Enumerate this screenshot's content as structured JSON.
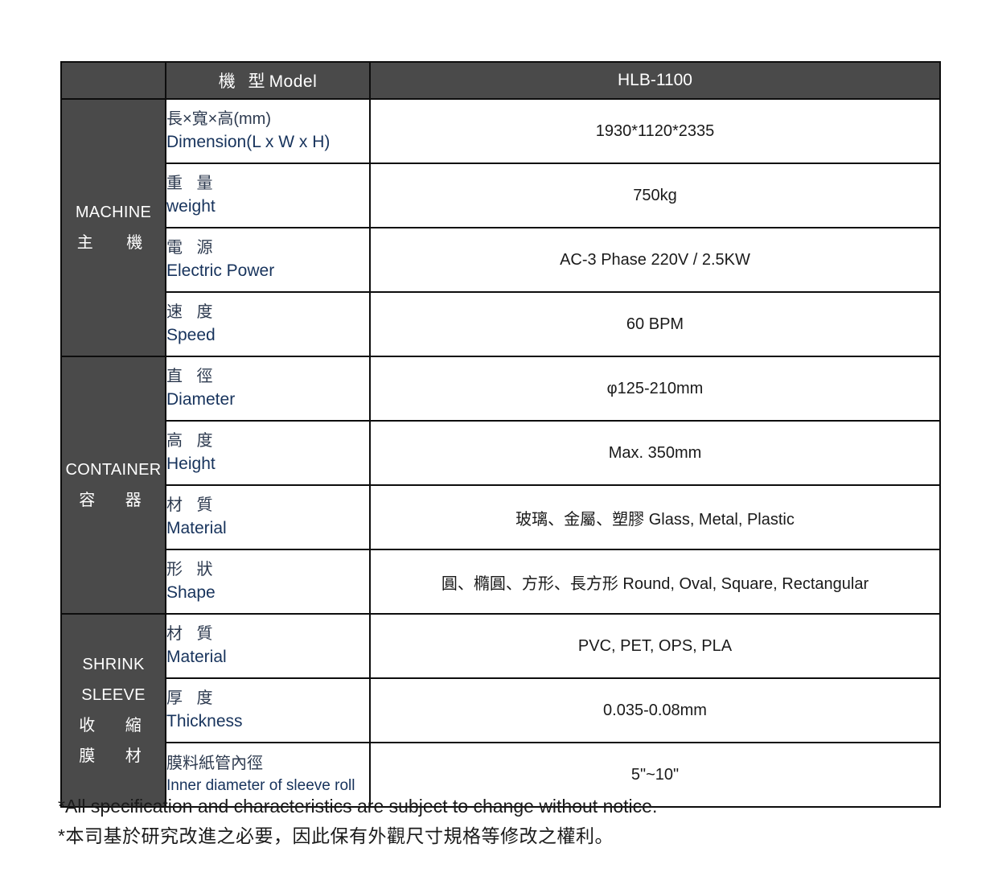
{
  "table": {
    "header": {
      "model_label_cjk": "機 型",
      "model_label_en": "Model",
      "model_value": "HLB-1100"
    },
    "groups": [
      {
        "name_en": "MACHINE",
        "name_cjk": "主 機",
        "rows": [
          {
            "label_cjk": "長×寬×高(mm)",
            "label_en": "Dimension(L x W x H)",
            "value": "1930*1120*2335"
          },
          {
            "label_cjk": "重 量",
            "label_en": "weight",
            "value": "750kg"
          },
          {
            "label_cjk": "電 源",
            "label_en": "Electric Power",
            "value": "AC-3 Phase 220V / 2.5KW"
          },
          {
            "label_cjk": "速 度",
            "label_en": "Speed",
            "value": "60 BPM"
          }
        ]
      },
      {
        "name_en": "CONTAINER",
        "name_cjk": "容 器",
        "rows": [
          {
            "label_cjk": "直 徑",
            "label_en": "Diameter",
            "value": "φ125-210mm"
          },
          {
            "label_cjk": "高 度",
            "label_en": "Height",
            "value": "Max. 350mm"
          },
          {
            "label_cjk": "材 質",
            "label_en": "Material",
            "value": "玻璃、金屬、塑膠 Glass, Metal, Plastic"
          },
          {
            "label_cjk": "形 狀",
            "label_en": "Shape",
            "value": "圓、橢圓、方形、長方形 Round, Oval, Square, Rectangular"
          }
        ]
      },
      {
        "name_en": "SHRINK SLEEVE",
        "name_cjk": "收 縮 膜 材",
        "rows": [
          {
            "label_cjk": "材 質",
            "label_en": "Material",
            "value": "PVC, PET, OPS, PLA"
          },
          {
            "label_cjk": "厚 度",
            "label_en": "Thickness",
            "value": "0.035-0.08mm"
          },
          {
            "label_cjk": "膜料紙管內徑",
            "label_en": "Inner diameter of sleeve roll",
            "value": "5\"~10\""
          }
        ]
      }
    ]
  },
  "footnotes": {
    "line1": "*All specification and characteristics are subject to change without notice.",
    "line2": "*本司基於研究改進之必要，因此保有外觀尺寸規格等修改之權利。"
  },
  "colors": {
    "header_bg": "#4a4a4a",
    "border": "#0d0d0d",
    "label_text": "#17335c",
    "value_text": "#1a1a1a"
  }
}
